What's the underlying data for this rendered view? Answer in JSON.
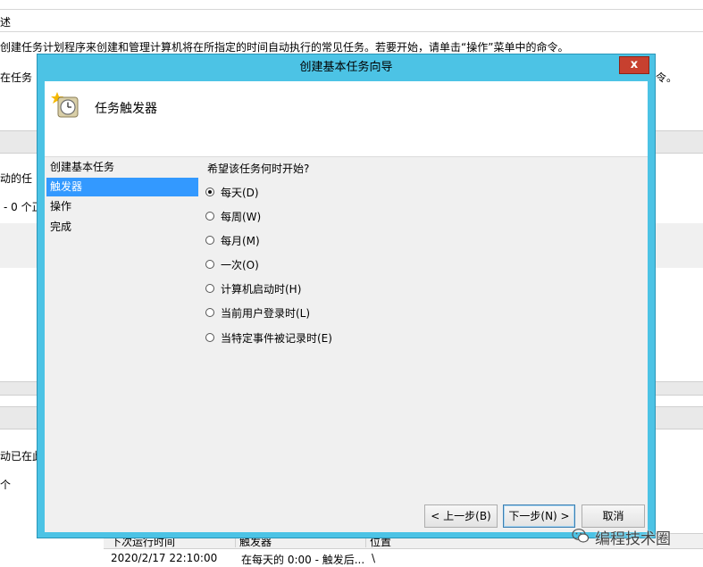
{
  "background": {
    "top_fragment": "述",
    "description": "创建任务计划程序来创建和管理计算机将在所指定的时间自动执行的常见任务。若要开始，请单击“操作”菜单中的命令。",
    "description_partial": "在任务",
    "right_fragment": "令。",
    "status_fragment1": "动的任",
    "status_fragment2": "- 0 个正",
    "active_fragment1": "动已在此",
    "active_fragment2": "个",
    "grid_headers": [
      "下次运行时间",
      "触发器",
      "位置"
    ],
    "grid_row": [
      "2020/2/17 22:10:00",
      "在每天的 0:00 - 触发后...",
      "\\"
    ]
  },
  "wizard": {
    "title": "创建基本任务向导",
    "close_label": "x",
    "header_title": "任务触发器",
    "nav_items": [
      "创建基本任务",
      "触发器",
      "操作",
      "完成"
    ],
    "question": "希望该任务何时开始?",
    "options": [
      {
        "label": "每天(D)",
        "checked": true
      },
      {
        "label": "每周(W)",
        "checked": false
      },
      {
        "label": "每月(M)",
        "checked": false
      },
      {
        "label": "一次(O)",
        "checked": false
      },
      {
        "label": "计算机启动时(H)",
        "checked": false
      },
      {
        "label": "当前用户登录时(L)",
        "checked": false
      },
      {
        "label": "当特定事件被记录时(E)",
        "checked": false
      }
    ],
    "buttons": {
      "back": "< 上一步(B)",
      "next": "下一步(N) >",
      "cancel": "取消"
    }
  },
  "watermark": {
    "text": "编程技术圈",
    "icon": "wechat-icon"
  },
  "colors": {
    "window_frame": "#4cc3e5",
    "close_button": "#c7402f",
    "selection": "#3399ff"
  }
}
